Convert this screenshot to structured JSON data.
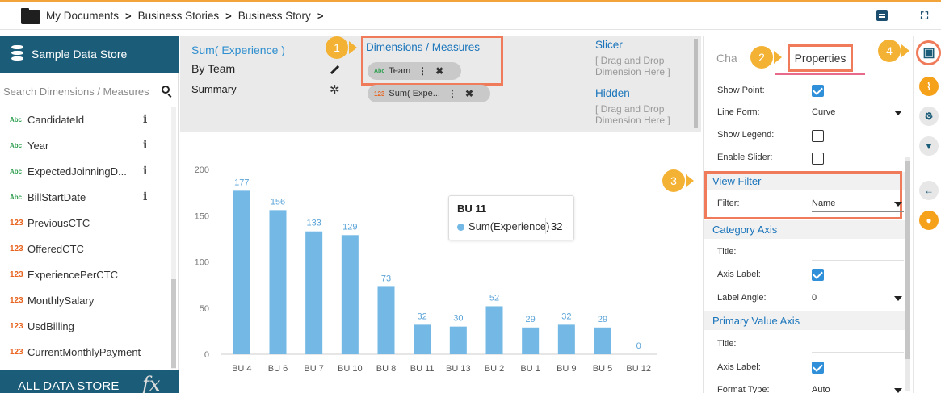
{
  "breadcrumb": [
    "My Documents",
    "Business Stories",
    "Business Story"
  ],
  "breadcrumb_sep": ">",
  "left_panel": {
    "store_title": "Sample Data Store",
    "search_placeholder": "Search Dimensions / Measures",
    "fields": [
      {
        "type": "Abc",
        "name": "CandidateId",
        "info": true
      },
      {
        "type": "Abc",
        "name": "Year",
        "info": true
      },
      {
        "type": "Abc",
        "name": "ExpectedJoinningD...",
        "info": true
      },
      {
        "type": "Abc",
        "name": "BillStartDate",
        "info": true
      },
      {
        "type": "123",
        "name": "PreviousCTC",
        "info": false
      },
      {
        "type": "123",
        "name": "OfferedCTC",
        "info": false
      },
      {
        "type": "123",
        "name": "ExperiencePerCTC",
        "info": false
      },
      {
        "type": "123",
        "name": "MonthlySalary",
        "info": false
      },
      {
        "type": "123",
        "name": "UsdBilling",
        "info": false
      },
      {
        "type": "123",
        "name": "CurrentMonthlyPayment",
        "info": false
      }
    ],
    "info_glyph": "i",
    "all_store_label": "ALL DATA STORE",
    "fx_label": "fx"
  },
  "config": {
    "chart_name": "Sum( Experience )",
    "by": "By Team",
    "summary": "Summary",
    "dims_title": "Dimensions / Measures",
    "pill1": {
      "type": "Abc",
      "label": "Team"
    },
    "pill2": {
      "type": "123",
      "label": "Sum( Expe..."
    },
    "slicer_title": "Slicer",
    "slicer_drop": "[ Drag and Drop Dimension Here ]",
    "hidden_title": "Hidden",
    "hidden_drop": "[ Drag and Drop Dimension Here ]"
  },
  "tooltip": {
    "title": "BU 11",
    "series": "Sum(Experience)",
    "value": "32"
  },
  "properties": {
    "tab_chart": "Cha",
    "tab_properties": "Properties",
    "show_point_label": "Show Point:",
    "show_point": true,
    "line_form_label": "Line Form:",
    "line_form": "Curve",
    "show_legend_label": "Show Legend:",
    "show_legend": false,
    "enable_slider_label": "Enable Slider:",
    "enable_slider": false,
    "view_filter_title": "View Filter",
    "filter_label": "Filter:",
    "filter_value": "Name",
    "category_axis_title": "Category Axis",
    "cat_title_label": "Title:",
    "cat_axis_label_label": "Axis Label:",
    "cat_axis_label": true,
    "label_angle_label": "Label Angle:",
    "label_angle": "0",
    "primary_value_axis_title": "Primary Value Axis",
    "pv_title_label": "Title:",
    "pv_axis_label_label": "Axis Label:",
    "pv_axis_label": true,
    "format_type_label": "Format Type:",
    "format_type": "Auto"
  },
  "rail_icons": [
    "save-icon",
    "line-chart-icon",
    "gears-icon",
    "filter-icon",
    "back-arrow-icon",
    "bulb-icon"
  ],
  "callouts": [
    "1",
    "2",
    "3",
    "4"
  ],
  "colors": {
    "bar": "#74b9e5",
    "label": "#5aa3d8",
    "accent": "#1b5c78",
    "highlight": "#ef7b5a",
    "callout": "#f4b234"
  },
  "chart_data": {
    "type": "bar",
    "categories": [
      "BU 4",
      "BU 6",
      "BU 7",
      "BU 10",
      "BU 8",
      "BU 11",
      "BU 13",
      "BU 2",
      "BU 1",
      "BU 9",
      "BU 5",
      "BU 12"
    ],
    "series": [
      {
        "name": "Sum(Experience)",
        "values": [
          177,
          156,
          133,
          129,
          73,
          32,
          30,
          52,
          29,
          32,
          29,
          0
        ]
      }
    ],
    "ylim": [
      0,
      200
    ],
    "yticks": [
      0,
      50,
      100,
      150,
      200
    ],
    "grid": false,
    "data_labels": true
  }
}
